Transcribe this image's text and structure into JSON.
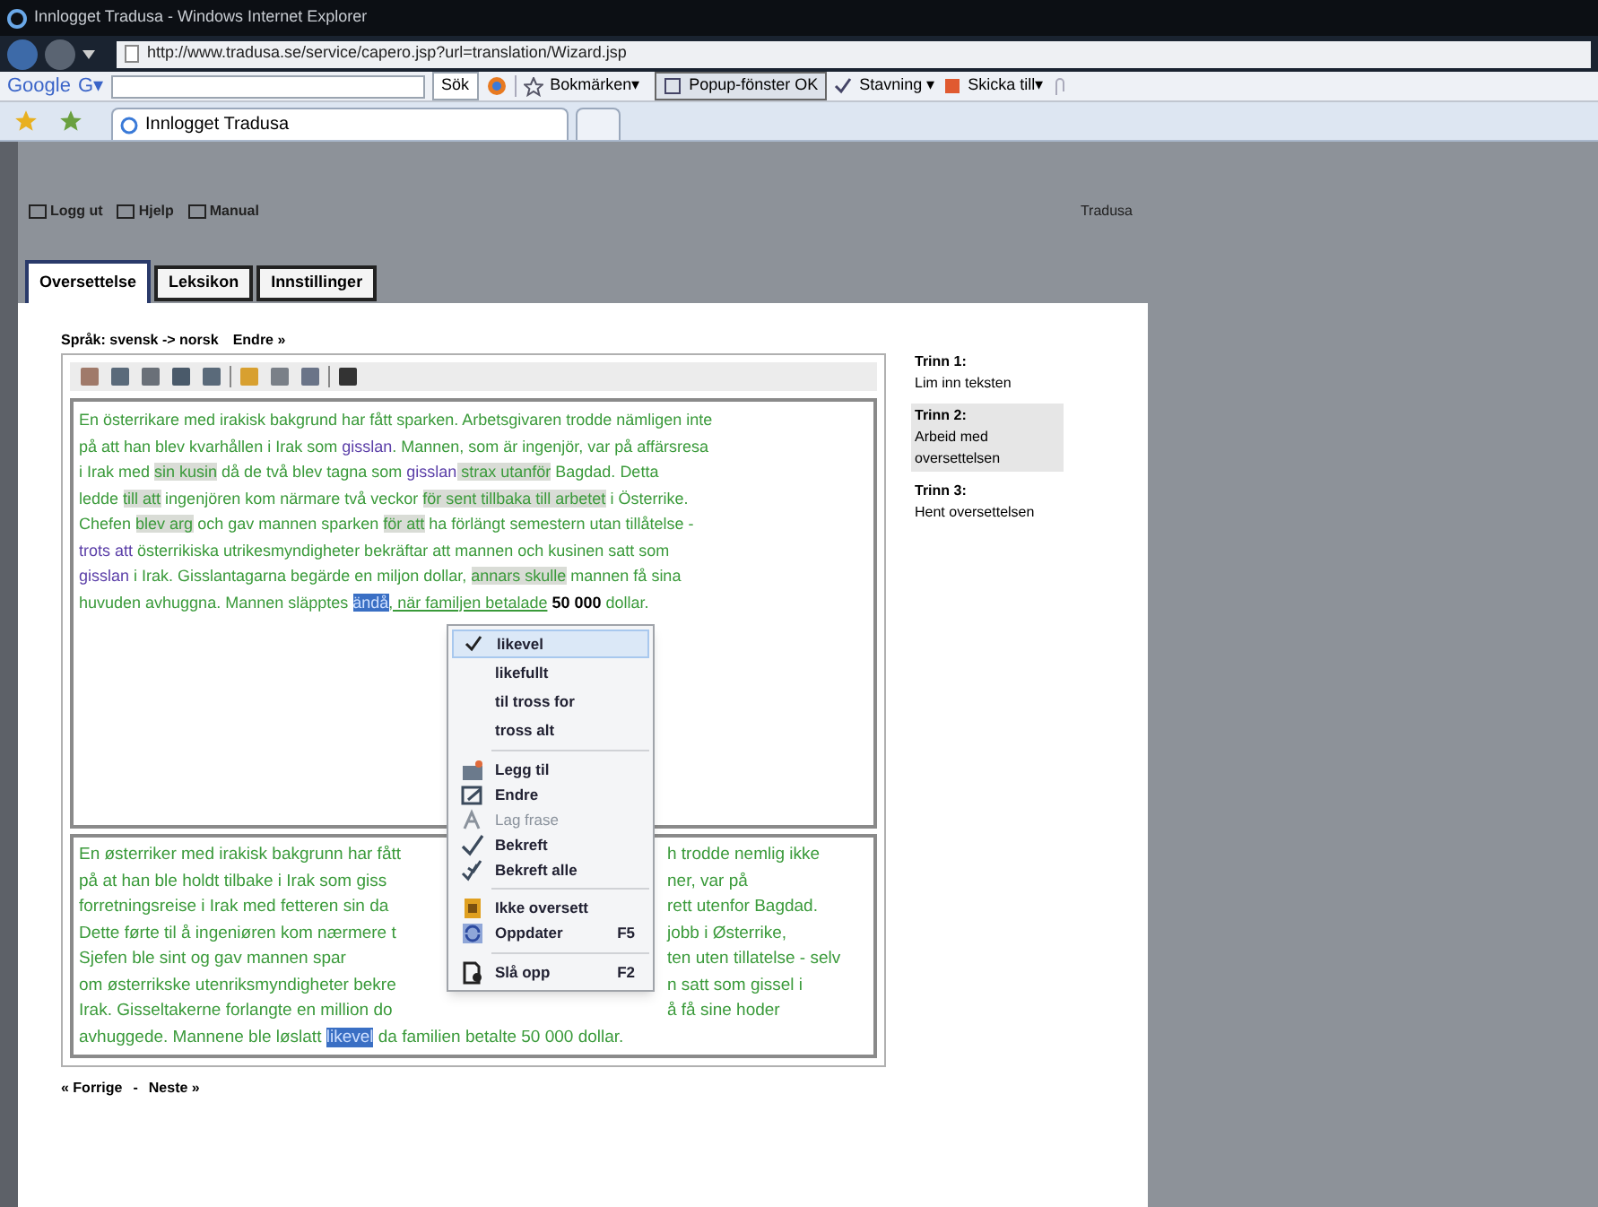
{
  "window": {
    "title": "Innlogget Tradusa - Windows Internet Explorer"
  },
  "address_bar": {
    "url": "http://www.tradusa.se/service/capero.jsp?url=translation/Wizard.jsp"
  },
  "google_toolbar": {
    "logo": "Google",
    "g_menu": "G▾",
    "search_button": "Sök",
    "bookmarks": "Bokmärken▾",
    "popup": "Popup-fönster OK",
    "spelling": "Stavning ▾",
    "send_to": "Skicka till▾"
  },
  "browser_tabs": [
    {
      "label": "Innlogget Tradusa",
      "selected": true
    }
  ],
  "page_header": {
    "links": [
      "Logg ut",
      "Hjelp",
      "Manual"
    ],
    "brand": "Tradusa"
  },
  "tabs": [
    {
      "label": "Oversettelse",
      "selected": true
    },
    {
      "label": "Leksikon",
      "selected": false
    },
    {
      "label": "Innstillinger",
      "selected": false
    }
  ],
  "language_pair": "Språk: svensk -> norsk",
  "change_link": "Endre »",
  "source_lines": [
    [
      {
        "kind": "text",
        "text": "En österrikare med irakisk bakgrund har fått sparken. Arbetsgivaren trodde nämligen inte"
      }
    ],
    [
      {
        "kind": "text",
        "text": "på att han blev kvarhållen i Irak som "
      },
      {
        "kind": "term",
        "text": "gisslan"
      },
      {
        "kind": "text",
        "text": ". Mannen, som är ingenjör, var på affärsresa"
      }
    ],
    [
      {
        "kind": "text",
        "text": "i Irak med "
      },
      {
        "kind": "unsure",
        "text": "sin kusin"
      },
      {
        "kind": "text",
        "text": " då de två blev tagna som "
      },
      {
        "kind": "term",
        "text": "gisslan"
      },
      {
        "kind": "unsure",
        "text": " strax utanför"
      },
      {
        "kind": "text",
        "text": " Bagdad. Detta"
      }
    ],
    [
      {
        "kind": "text",
        "text": "ledde "
      },
      {
        "kind": "unsure",
        "text": "till att"
      },
      {
        "kind": "text",
        "text": " ingenjören kom närmare två veckor "
      },
      {
        "kind": "unsure",
        "text": "för sent tillbaka till arbetet"
      },
      {
        "kind": "text",
        "text": " i Österrike."
      }
    ],
    [
      {
        "kind": "text",
        "text": "Chefen "
      },
      {
        "kind": "unsure",
        "text": "blev arg"
      },
      {
        "kind": "text",
        "text": " och gav mannen sparken "
      },
      {
        "kind": "unsure",
        "text": "för att"
      },
      {
        "kind": "text",
        "text": " ha förlängt semestern utan tillåtelse -"
      }
    ],
    [
      {
        "kind": "term",
        "text": "trots att"
      },
      {
        "kind": "text",
        "text": " österrikiska utrikesmyndigheter bekräftar att mannen och kusinen satt som"
      }
    ],
    [
      {
        "kind": "term",
        "text": "gisslan"
      },
      {
        "kind": "text",
        "text": " i Irak. Gisslantagarna begärde en miljon dollar, "
      },
      {
        "kind": "unsure",
        "text": "annars skulle"
      },
      {
        "kind": "text",
        "text": " mannen få sina"
      }
    ],
    [
      {
        "kind": "text",
        "text": "huvuden avhuggna. Mannen släpptes "
      },
      {
        "kind": "selected",
        "text": "ändå"
      },
      {
        "kind": "link",
        "text": ", när familjen betalade"
      },
      {
        "kind": "number",
        "text": " 50 000"
      },
      {
        "kind": "text",
        "text": " dollar."
      }
    ]
  ],
  "target_lines": [
    {
      "left": "En østerriker med irakisk bakgrunn har fått",
      "right": "h trodde nemlig ikke"
    },
    {
      "left": "på at han ble holdt tilbake i Irak som giss",
      "right": "ner, var på"
    },
    {
      "left": "forretningsreise i Irak med fetteren sin da",
      "right": "rett utenfor Bagdad."
    },
    {
      "left": "Dette førte til å ingeniøren kom nærmere t",
      "right": "jobb i Østerrike,"
    },
    {
      "left": "Sjefen ble sint og gav mannen spar",
      "right": "ten uten tillatelse - selv"
    },
    {
      "left": "om østerrikske utenriksmyndigheter bekre",
      "right": "n satt som gissel i"
    },
    {
      "left": "Irak. Gisseltakerne forlangte en million do",
      "right": "å få sine hoder"
    }
  ],
  "target_last_line": [
    {
      "kind": "text",
      "text": "avhuggede. Mannene ble løslatt "
    },
    {
      "kind": "selected",
      "text": "likevel"
    },
    {
      "kind": "text",
      "text": " da familien betalte 50 000 dollar."
    }
  ],
  "context_menu": [
    {
      "kind": "suggestion",
      "label": "likevel",
      "checked": true
    },
    {
      "kind": "suggestion",
      "label": "likefullt",
      "checked": false
    },
    {
      "kind": "suggestion",
      "label": "til tross for",
      "checked": false
    },
    {
      "kind": "suggestion",
      "label": "tross alt",
      "checked": false
    },
    {
      "kind": "separator"
    },
    {
      "kind": "action",
      "label": "Legg til",
      "disabled": false
    },
    {
      "kind": "action",
      "label": "Endre",
      "disabled": false
    },
    {
      "kind": "action",
      "label": "Lag frase",
      "disabled": true
    },
    {
      "kind": "action",
      "label": "Bekreft",
      "disabled": false
    },
    {
      "kind": "action",
      "label": "Bekreft alle",
      "disabled": false
    },
    {
      "kind": "separator"
    },
    {
      "kind": "action",
      "label": "Ikke oversett",
      "disabled": false
    },
    {
      "kind": "action",
      "label": "Oppdater",
      "shortcut": "F5",
      "disabled": false
    },
    {
      "kind": "separator"
    },
    {
      "kind": "action",
      "label": "Slå opp",
      "shortcut": "F2",
      "disabled": false
    }
  ],
  "steps": [
    {
      "title": "Trinn 1:",
      "label": "Lim inn teksten",
      "selected": false
    },
    {
      "title": "Trinn 2:",
      "label": "Arbeid med oversettelsen",
      "selected": true
    },
    {
      "title": "Trinn 3:",
      "label": "Hent oversettelsen",
      "selected": false
    }
  ],
  "pager": {
    "previous": "« Forrige",
    "separator": "-",
    "next": "Neste »"
  }
}
